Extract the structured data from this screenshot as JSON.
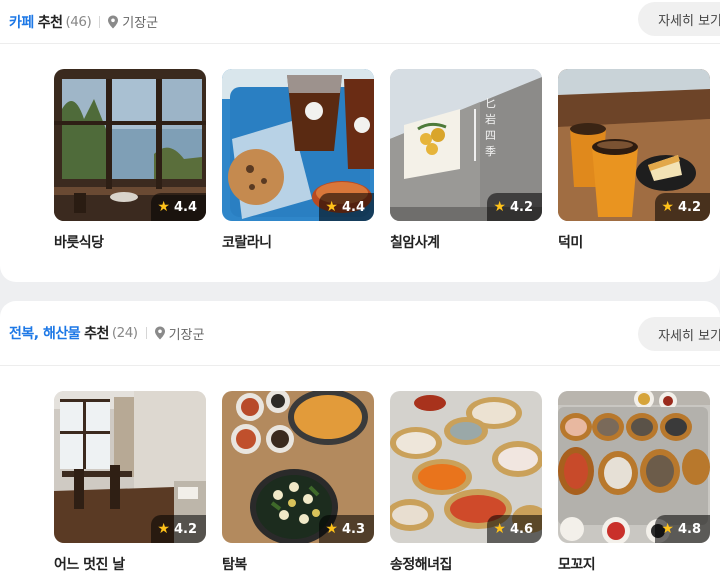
{
  "sections": [
    {
      "title_accent": "카페",
      "title_rest": "추천",
      "count": "(46)",
      "location": "기장군",
      "more_label": "자세히 보기",
      "items": [
        {
          "name": "바릇식당",
          "rating": "4.4"
        },
        {
          "name": "코랄라니",
          "rating": "4.4"
        },
        {
          "name": "칠암사계",
          "rating": "4.2"
        },
        {
          "name": "덕미",
          "rating": "4.2"
        }
      ]
    },
    {
      "title_accent": "전복, 해산물",
      "title_rest": "추천",
      "count": "(24)",
      "location": "기장군",
      "more_label": "자세히 보기",
      "items": [
        {
          "name": "어느 멋진 날",
          "rating": "4.2"
        },
        {
          "name": "탐복",
          "rating": "4.3"
        },
        {
          "name": "송정해녀집",
          "rating": "4.6"
        },
        {
          "name": "모꼬지",
          "rating": "4.8"
        }
      ]
    }
  ],
  "colors": {
    "accent": "#1d78e6",
    "star": "#ffc21a"
  }
}
